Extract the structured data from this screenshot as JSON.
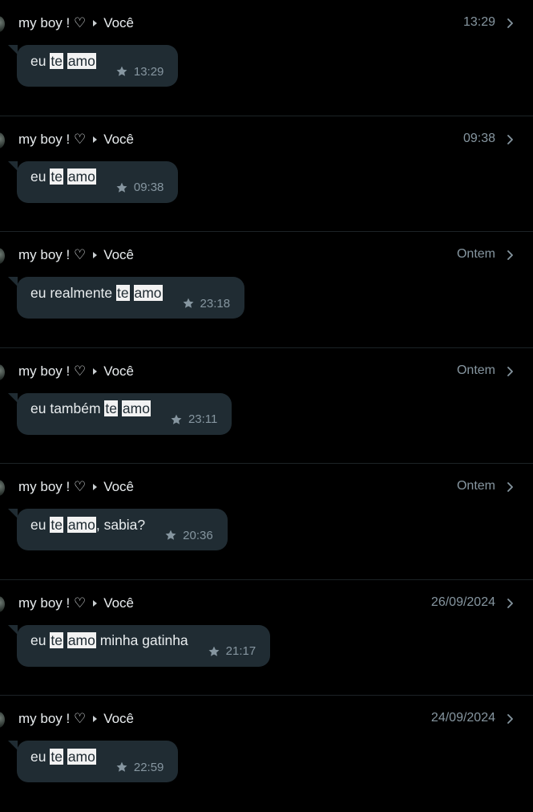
{
  "colors": {
    "background": "#000000",
    "bubble": "#202c33",
    "secondary_text": "#8696a0",
    "highlight": "#f2f2f2"
  },
  "icons": [
    "star-icon",
    "chevron-right-icon",
    "avatar"
  ],
  "results": [
    {
      "sender": "my boy ! ♡",
      "recipient": "Você",
      "date": "13:29",
      "message_parts": [
        {
          "text": "eu ",
          "highlight": false
        },
        {
          "text": "te",
          "highlight": true
        },
        {
          "text": " ",
          "highlight": false
        },
        {
          "text": "amo",
          "highlight": true
        }
      ],
      "time": "13:29",
      "starred": true
    },
    {
      "sender": "my boy ! ♡",
      "recipient": "Você",
      "date": "09:38",
      "message_parts": [
        {
          "text": "eu ",
          "highlight": false
        },
        {
          "text": "te",
          "highlight": true
        },
        {
          "text": " ",
          "highlight": false
        },
        {
          "text": "amo",
          "highlight": true
        }
      ],
      "time": "09:38",
      "starred": true
    },
    {
      "sender": "my boy ! ♡",
      "recipient": "Você",
      "date": "Ontem",
      "message_parts": [
        {
          "text": "eu realmente ",
          "highlight": false
        },
        {
          "text": "te",
          "highlight": true
        },
        {
          "text": " ",
          "highlight": false
        },
        {
          "text": "amo",
          "highlight": true
        }
      ],
      "time": "23:18",
      "starred": true
    },
    {
      "sender": "my boy ! ♡",
      "recipient": "Você",
      "date": "Ontem",
      "message_parts": [
        {
          "text": "eu também ",
          "highlight": false
        },
        {
          "text": "te",
          "highlight": true
        },
        {
          "text": " ",
          "highlight": false
        },
        {
          "text": "amo",
          "highlight": true
        }
      ],
      "time": "23:11",
      "starred": true
    },
    {
      "sender": "my boy ! ♡",
      "recipient": "Você",
      "date": "Ontem",
      "message_parts": [
        {
          "text": "eu ",
          "highlight": false
        },
        {
          "text": "te",
          "highlight": true
        },
        {
          "text": " ",
          "highlight": false
        },
        {
          "text": "amo",
          "highlight": true
        },
        {
          "text": ", sabia?",
          "highlight": false
        }
      ],
      "time": "20:36",
      "starred": true
    },
    {
      "sender": "my boy ! ♡",
      "recipient": "Você",
      "date": "26/09/2024",
      "message_parts": [
        {
          "text": "eu ",
          "highlight": false
        },
        {
          "text": "te",
          "highlight": true
        },
        {
          "text": " ",
          "highlight": false
        },
        {
          "text": "amo",
          "highlight": true
        },
        {
          "text": " minha gatinha",
          "highlight": false
        }
      ],
      "time": "21:17",
      "starred": true
    },
    {
      "sender": "my boy ! ♡",
      "recipient": "Você",
      "date": "24/09/2024",
      "message_parts": [
        {
          "text": "eu ",
          "highlight": false
        },
        {
          "text": "te",
          "highlight": true
        },
        {
          "text": " ",
          "highlight": false
        },
        {
          "text": "amo",
          "highlight": true
        }
      ],
      "time": "22:59",
      "starred": true
    }
  ]
}
